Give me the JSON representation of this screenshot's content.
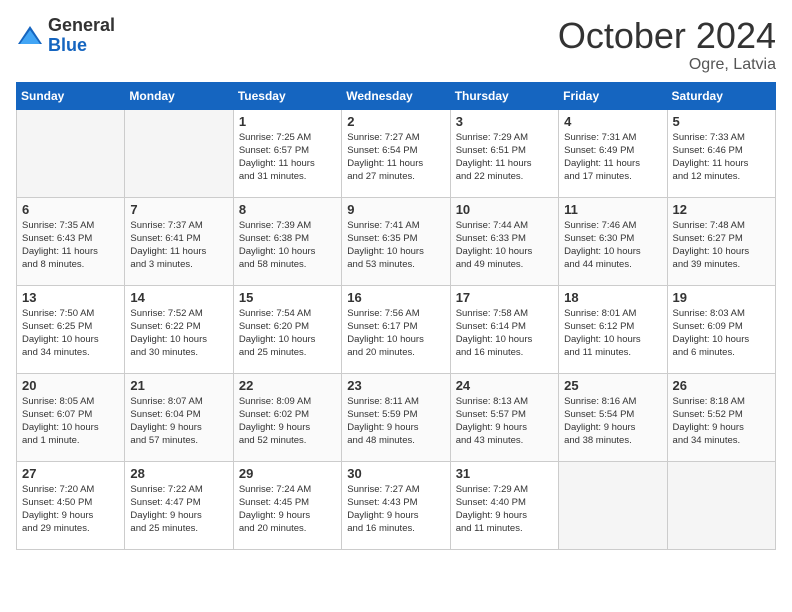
{
  "logo": {
    "general": "General",
    "blue": "Blue"
  },
  "title": "October 2024",
  "location": "Ogre, Latvia",
  "weekdays": [
    "Sunday",
    "Monday",
    "Tuesday",
    "Wednesday",
    "Thursday",
    "Friday",
    "Saturday"
  ],
  "weeks": [
    [
      {
        "day": "",
        "info": ""
      },
      {
        "day": "",
        "info": ""
      },
      {
        "day": "1",
        "info": "Sunrise: 7:25 AM\nSunset: 6:57 PM\nDaylight: 11 hours\nand 31 minutes."
      },
      {
        "day": "2",
        "info": "Sunrise: 7:27 AM\nSunset: 6:54 PM\nDaylight: 11 hours\nand 27 minutes."
      },
      {
        "day": "3",
        "info": "Sunrise: 7:29 AM\nSunset: 6:51 PM\nDaylight: 11 hours\nand 22 minutes."
      },
      {
        "day": "4",
        "info": "Sunrise: 7:31 AM\nSunset: 6:49 PM\nDaylight: 11 hours\nand 17 minutes."
      },
      {
        "day": "5",
        "info": "Sunrise: 7:33 AM\nSunset: 6:46 PM\nDaylight: 11 hours\nand 12 minutes."
      }
    ],
    [
      {
        "day": "6",
        "info": "Sunrise: 7:35 AM\nSunset: 6:43 PM\nDaylight: 11 hours\nand 8 minutes."
      },
      {
        "day": "7",
        "info": "Sunrise: 7:37 AM\nSunset: 6:41 PM\nDaylight: 11 hours\nand 3 minutes."
      },
      {
        "day": "8",
        "info": "Sunrise: 7:39 AM\nSunset: 6:38 PM\nDaylight: 10 hours\nand 58 minutes."
      },
      {
        "day": "9",
        "info": "Sunrise: 7:41 AM\nSunset: 6:35 PM\nDaylight: 10 hours\nand 53 minutes."
      },
      {
        "day": "10",
        "info": "Sunrise: 7:44 AM\nSunset: 6:33 PM\nDaylight: 10 hours\nand 49 minutes."
      },
      {
        "day": "11",
        "info": "Sunrise: 7:46 AM\nSunset: 6:30 PM\nDaylight: 10 hours\nand 44 minutes."
      },
      {
        "day": "12",
        "info": "Sunrise: 7:48 AM\nSunset: 6:27 PM\nDaylight: 10 hours\nand 39 minutes."
      }
    ],
    [
      {
        "day": "13",
        "info": "Sunrise: 7:50 AM\nSunset: 6:25 PM\nDaylight: 10 hours\nand 34 minutes."
      },
      {
        "day": "14",
        "info": "Sunrise: 7:52 AM\nSunset: 6:22 PM\nDaylight: 10 hours\nand 30 minutes."
      },
      {
        "day": "15",
        "info": "Sunrise: 7:54 AM\nSunset: 6:20 PM\nDaylight: 10 hours\nand 25 minutes."
      },
      {
        "day": "16",
        "info": "Sunrise: 7:56 AM\nSunset: 6:17 PM\nDaylight: 10 hours\nand 20 minutes."
      },
      {
        "day": "17",
        "info": "Sunrise: 7:58 AM\nSunset: 6:14 PM\nDaylight: 10 hours\nand 16 minutes."
      },
      {
        "day": "18",
        "info": "Sunrise: 8:01 AM\nSunset: 6:12 PM\nDaylight: 10 hours\nand 11 minutes."
      },
      {
        "day": "19",
        "info": "Sunrise: 8:03 AM\nSunset: 6:09 PM\nDaylight: 10 hours\nand 6 minutes."
      }
    ],
    [
      {
        "day": "20",
        "info": "Sunrise: 8:05 AM\nSunset: 6:07 PM\nDaylight: 10 hours\nand 1 minute."
      },
      {
        "day": "21",
        "info": "Sunrise: 8:07 AM\nSunset: 6:04 PM\nDaylight: 9 hours\nand 57 minutes."
      },
      {
        "day": "22",
        "info": "Sunrise: 8:09 AM\nSunset: 6:02 PM\nDaylight: 9 hours\nand 52 minutes."
      },
      {
        "day": "23",
        "info": "Sunrise: 8:11 AM\nSunset: 5:59 PM\nDaylight: 9 hours\nand 48 minutes."
      },
      {
        "day": "24",
        "info": "Sunrise: 8:13 AM\nSunset: 5:57 PM\nDaylight: 9 hours\nand 43 minutes."
      },
      {
        "day": "25",
        "info": "Sunrise: 8:16 AM\nSunset: 5:54 PM\nDaylight: 9 hours\nand 38 minutes."
      },
      {
        "day": "26",
        "info": "Sunrise: 8:18 AM\nSunset: 5:52 PM\nDaylight: 9 hours\nand 34 minutes."
      }
    ],
    [
      {
        "day": "27",
        "info": "Sunrise: 7:20 AM\nSunset: 4:50 PM\nDaylight: 9 hours\nand 29 minutes."
      },
      {
        "day": "28",
        "info": "Sunrise: 7:22 AM\nSunset: 4:47 PM\nDaylight: 9 hours\nand 25 minutes."
      },
      {
        "day": "29",
        "info": "Sunrise: 7:24 AM\nSunset: 4:45 PM\nDaylight: 9 hours\nand 20 minutes."
      },
      {
        "day": "30",
        "info": "Sunrise: 7:27 AM\nSunset: 4:43 PM\nDaylight: 9 hours\nand 16 minutes."
      },
      {
        "day": "31",
        "info": "Sunrise: 7:29 AM\nSunset: 4:40 PM\nDaylight: 9 hours\nand 11 minutes."
      },
      {
        "day": "",
        "info": ""
      },
      {
        "day": "",
        "info": ""
      }
    ]
  ]
}
